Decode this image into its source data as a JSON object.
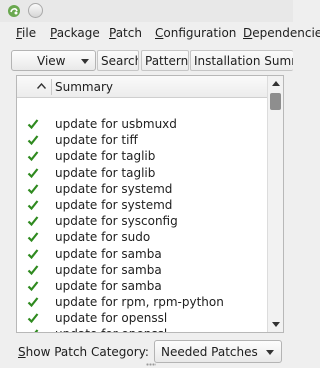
{
  "menubar": {
    "items": [
      {
        "label": "File",
        "mnemonic": "F",
        "rest": "ile"
      },
      {
        "label": "Package",
        "mnemonic": "P",
        "rest": "ackage"
      },
      {
        "label": "Patch",
        "mnemonic": "P",
        "rest": "atch"
      },
      {
        "label": "Configuration",
        "mnemonic": "C",
        "rest": "onfiguration"
      },
      {
        "label": "Dependencies",
        "mnemonic": "D",
        "rest": "ependencies"
      }
    ]
  },
  "toolbar": {
    "view_label": "View",
    "tabs": [
      "Search",
      "Patterns",
      "Installation Summary"
    ]
  },
  "table": {
    "column_title": "Summary",
    "rows": [
      "update for usbmuxd",
      "update for tiff",
      "update for taglib",
      "update for taglib",
      "update for systemd",
      "update for systemd",
      "update for sysconfig",
      "update for sudo",
      "update for samba",
      "update for samba",
      "update for samba",
      "update for rpm, rpm-python",
      "update for openssl",
      "update for openssl"
    ]
  },
  "bottom": {
    "category_label_mnemonic": "S",
    "category_label_rest": "how Patch Category:",
    "category_value": "Needed Patches"
  },
  "colors": {
    "check_green": "#2f8a1f",
    "window_bg": "#efefef"
  }
}
